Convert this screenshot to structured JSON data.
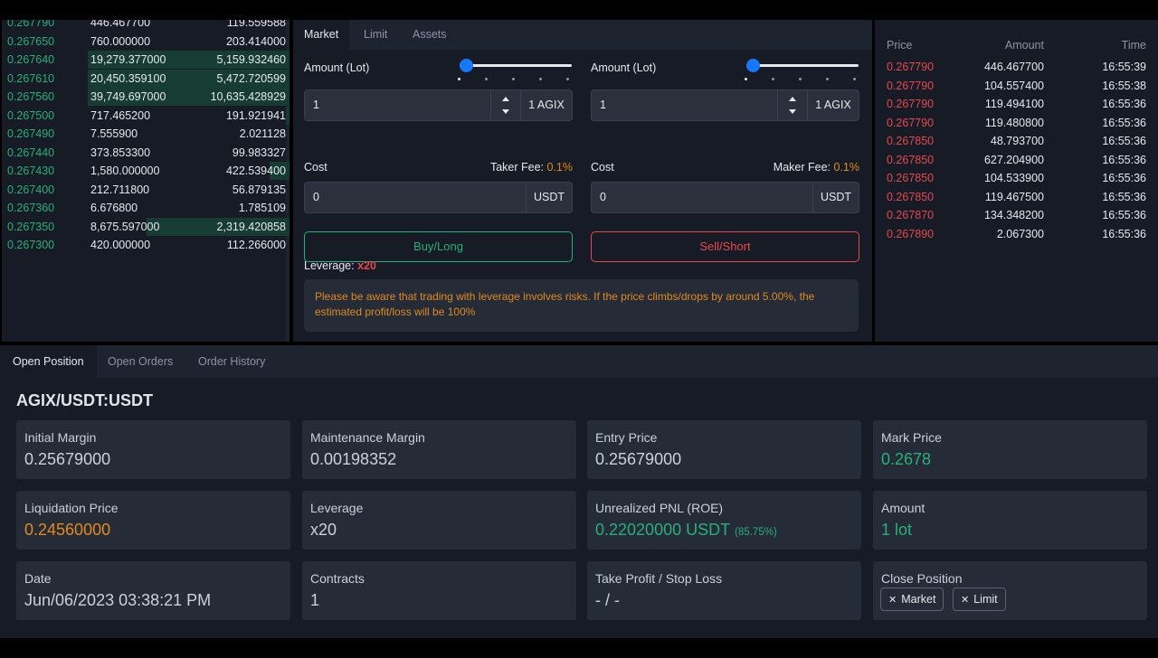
{
  "orderbook": {
    "rows": [
      {
        "price": "0.267790",
        "amount": "446.467700",
        "total": "119.559588",
        "fill": 0
      },
      {
        "price": "0.267650",
        "amount": "760.000000",
        "total": "203.414000",
        "fill": 0
      },
      {
        "price": "0.267640",
        "amount": "19,279.377000",
        "total": "5,159.932460",
        "fill": 1.0
      },
      {
        "price": "0.267610",
        "amount": "20,450.359100",
        "total": "5,472.720599",
        "fill": 1.0
      },
      {
        "price": "0.267560",
        "amount": "39,749.697000",
        "total": "10,635.428929",
        "fill": 1.0
      },
      {
        "price": "0.267500",
        "amount": "717.465200",
        "total": "191.921941",
        "fill": 0.02
      },
      {
        "price": "0.267490",
        "amount": "7.555900",
        "total": "2.021128",
        "fill": 0
      },
      {
        "price": "0.267440",
        "amount": "373.853300",
        "total": "99.983327",
        "fill": 0
      },
      {
        "price": "0.267430",
        "amount": "1,580.000000",
        "total": "422.539400",
        "fill": 0.1
      },
      {
        "price": "0.267400",
        "amount": "212.711800",
        "total": "56.879135",
        "fill": 0
      },
      {
        "price": "0.267360",
        "amount": "6.676800",
        "total": "1.785109",
        "fill": 0
      },
      {
        "price": "0.267350",
        "amount": "8,675.597000",
        "total": "2,319.420858",
        "fill": 0.71
      },
      {
        "price": "0.267300",
        "amount": "420.000000",
        "total": "112.266000",
        "fill": 0
      }
    ]
  },
  "trade": {
    "tabs": [
      "Market",
      "Limit",
      "Assets"
    ],
    "buy": {
      "amount_label": "Amount (Lot)",
      "amount_value": "1",
      "amount_unit": "1 AGIX",
      "cost_label": "Cost",
      "fee_label": "Taker Fee:",
      "fee_pct": "0.1%",
      "cost_value": "0",
      "cost_unit": "USDT",
      "button": "Buy/Long",
      "slider_level": 0
    },
    "sell": {
      "amount_label": "Amount (Lot)",
      "amount_value": "1",
      "amount_unit": "1 AGIX",
      "cost_label": "Cost",
      "fee_label": "Maker Fee:",
      "fee_pct": "0.1%",
      "cost_value": "0",
      "cost_unit": "USDT",
      "button": "Sell/Short",
      "slider_level": 0
    },
    "leverage_label": "Leverage:",
    "leverage_value": "x20",
    "warning": "Please be aware that trading with leverage involves risks. If the price climbs/drops by around 5.00%, the estimated profit/loss will be 100%"
  },
  "trades": {
    "headers": {
      "price": "Price",
      "amount": "Amount",
      "time": "Time"
    },
    "rows": [
      {
        "price": "0.267790",
        "amount": "446.467700",
        "time": "16:55:39"
      },
      {
        "price": "0.267790",
        "amount": "104.557400",
        "time": "16:55:38"
      },
      {
        "price": "0.267790",
        "amount": "119.494100",
        "time": "16:55:36"
      },
      {
        "price": "0.267790",
        "amount": "119.480800",
        "time": "16:55:36"
      },
      {
        "price": "0.267850",
        "amount": "48.793700",
        "time": "16:55:36"
      },
      {
        "price": "0.267850",
        "amount": "627.204900",
        "time": "16:55:36"
      },
      {
        "price": "0.267850",
        "amount": "104.533900",
        "time": "16:55:36"
      },
      {
        "price": "0.267850",
        "amount": "119.467500",
        "time": "16:55:36"
      },
      {
        "price": "0.267870",
        "amount": "134.348200",
        "time": "16:55:36"
      },
      {
        "price": "0.267890",
        "amount": "2.067300",
        "time": "16:55:36"
      }
    ]
  },
  "positions": {
    "tabs": [
      "Open Position",
      "Open Orders",
      "Order History"
    ],
    "symbol": "AGIX/USDT:USDT",
    "cards": {
      "initial_margin": {
        "label": "Initial Margin",
        "value": "0.25679000"
      },
      "maintenance_margin": {
        "label": "Maintenance Margin",
        "value": "0.00198352"
      },
      "entry_price": {
        "label": "Entry Price",
        "value": "0.25679000"
      },
      "mark_price": {
        "label": "Mark Price",
        "value": "0.2678"
      },
      "liquidation_price": {
        "label": "Liquidation Price",
        "value": "0.24560000"
      },
      "leverage": {
        "label": "Leverage",
        "value": "x20"
      },
      "unrealized_pnl": {
        "label": "Unrealized PNL (ROE)",
        "value": "0.22020000 USDT",
        "roe": "(85.75%)"
      },
      "amount": {
        "label": "Amount",
        "value": "1 lot"
      },
      "date": {
        "label": "Date",
        "value": "Jun/06/2023 03:38:21 PM"
      },
      "contracts": {
        "label": "Contracts",
        "value": "1"
      },
      "tpsl": {
        "label": "Take Profit / Stop Loss",
        "value": "- / -"
      },
      "close_position": {
        "label": "Close Position",
        "market": "Market",
        "limit": "Limit"
      }
    }
  },
  "colors": {
    "green": "#26b07a",
    "red": "#e5484d",
    "orange": "#e08a1e",
    "accent": "#1677ff"
  }
}
